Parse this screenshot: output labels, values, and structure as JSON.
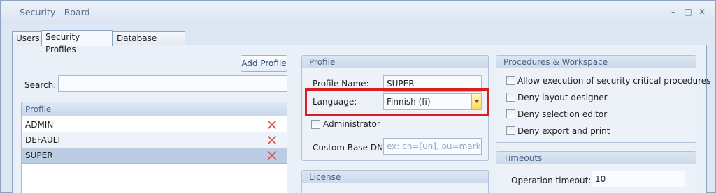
{
  "window": {
    "title": "Security - Board",
    "controls": [
      "–",
      "□",
      "✕"
    ]
  },
  "tabs": [
    {
      "label": "Users",
      "active": false
    },
    {
      "label": "Security Profiles",
      "active": true
    },
    {
      "label": "Database Security",
      "active": false
    }
  ],
  "profiles_list": {
    "add_button": "Add Profile",
    "search_label": "Search:",
    "search_value": "",
    "column_header": "Profile",
    "rows": [
      {
        "name": "ADMIN",
        "selected": false
      },
      {
        "name": "DEFAULT",
        "selected": false
      },
      {
        "name": "SUPER",
        "selected": true
      }
    ]
  },
  "profile_panel": {
    "title": "Profile",
    "name_label": "Profile Name:",
    "name_value": "SUPER",
    "language_label": "Language:",
    "language_value": "Finnish (fi)",
    "administrator_label": "Administrator",
    "administrator_checked": false,
    "base_dn_label": "Custom Base DN:",
    "base_dn_placeholder": "ex: cn=[un], ou=market..."
  },
  "license_panel": {
    "title": "License"
  },
  "procedures_panel": {
    "title": "Procedures & Workspace",
    "options": [
      {
        "label": "Allow execution of security critical procedures",
        "checked": false
      },
      {
        "label": "Deny layout designer",
        "checked": false
      },
      {
        "label": "Deny selection editor",
        "checked": false
      },
      {
        "label": "Deny export and print",
        "checked": false
      }
    ]
  },
  "timeouts_panel": {
    "title": "Timeouts",
    "operation_timeout_label": "Operation timeout:",
    "operation_timeout_value": "10"
  },
  "colors": {
    "highlight": "#d81e1e",
    "delete_icon": "#d9534f",
    "selected_row": "#bccde3"
  },
  "icons": {
    "delete": "delete-x-icon"
  }
}
